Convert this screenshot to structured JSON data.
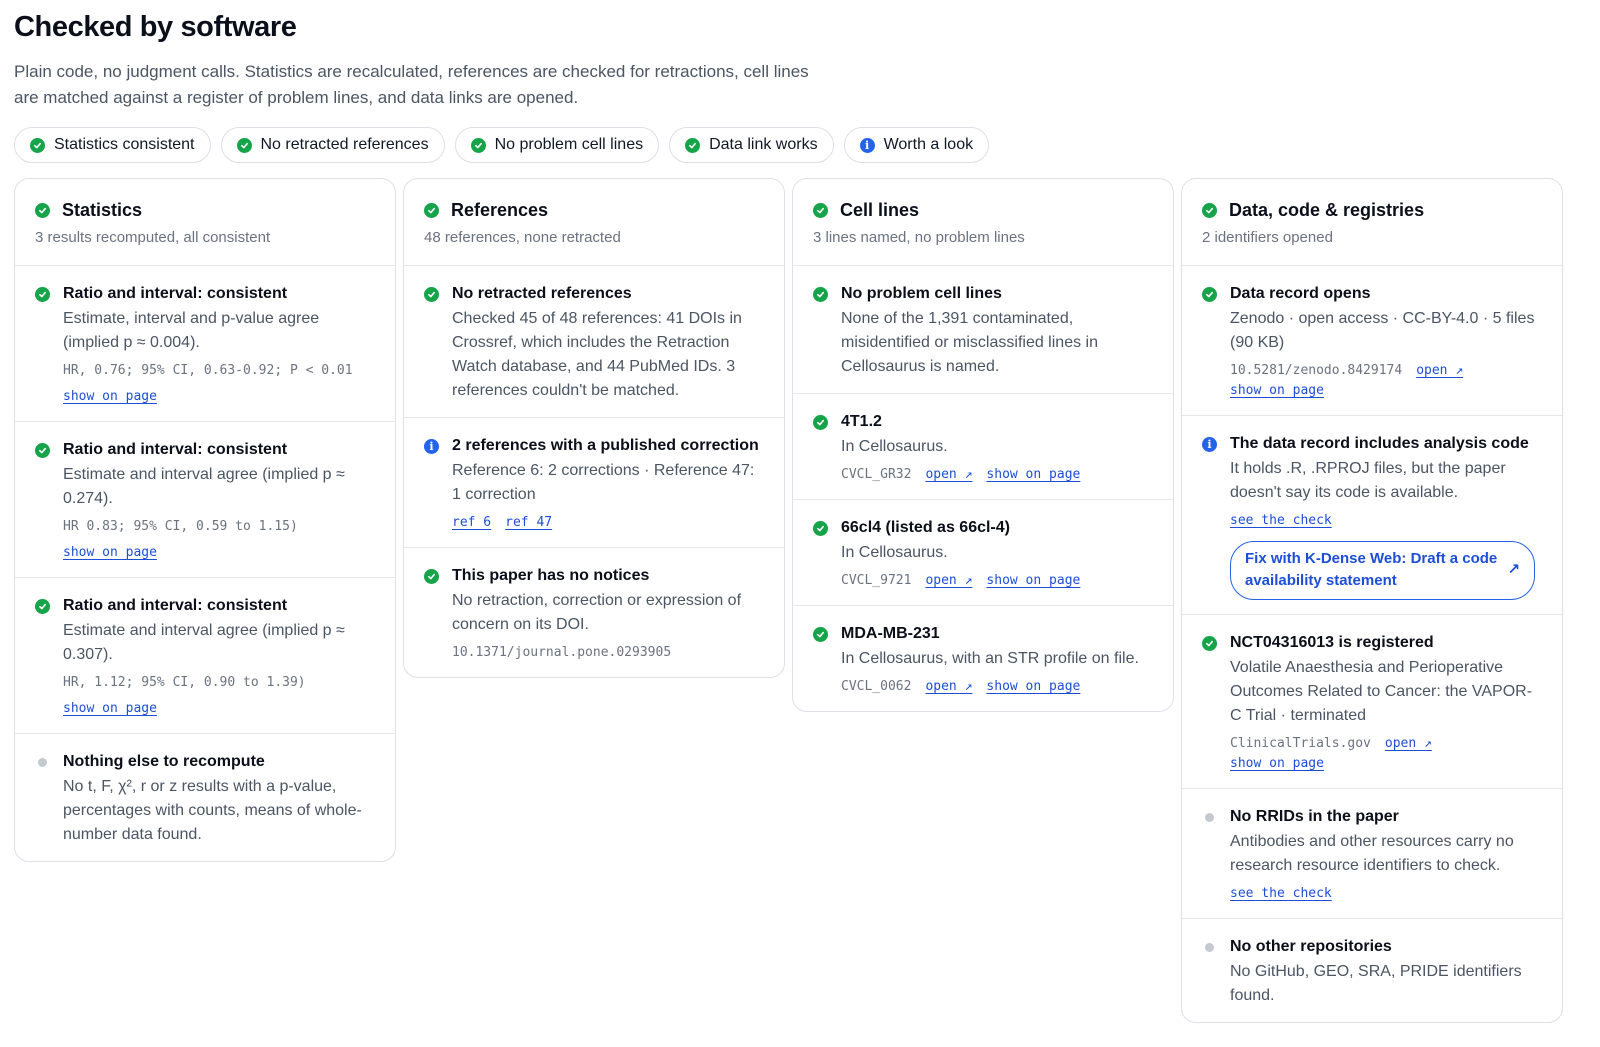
{
  "header": {
    "title": "Checked by software",
    "intro": "Plain code, no judgment calls. Statistics are recalculated, references are checked for retractions, cell lines are matched against a register of problem lines, and data links are opened."
  },
  "chips": [
    {
      "label": "Statistics consistent",
      "status": "ok"
    },
    {
      "label": "No retracted references",
      "status": "ok"
    },
    {
      "label": "No problem cell lines",
      "status": "ok"
    },
    {
      "label": "Data link works",
      "status": "ok"
    },
    {
      "label": "Worth a look",
      "status": "info"
    }
  ],
  "cards": {
    "statistics": {
      "title": "Statistics",
      "subtitle": "3 results recomputed, all consistent",
      "items": [
        {
          "title": "Ratio and interval: consistent",
          "text": "Estimate, interval and p-value agree (implied p ≈ 0.004).",
          "code": "HR, 0.76; 95% CI, 0.63-0.92; P < 0.01",
          "link": "show on page"
        },
        {
          "title": "Ratio and interval: consistent",
          "text": "Estimate and interval agree (implied p ≈ 0.274).",
          "code": "HR 0.83; 95% CI, 0.59 to 1.15)",
          "link": "show on page"
        },
        {
          "title": "Ratio and interval: consistent",
          "text": "Estimate and interval agree (implied p ≈ 0.307).",
          "code": "HR, 1.12; 95% CI, 0.90 to 1.39)",
          "link": "show on page"
        },
        {
          "title": "Nothing else to recompute",
          "text": "No t, F, χ², r or z results with a p-value, percentages with counts, means of whole-number data found."
        }
      ]
    },
    "references": {
      "title": "References",
      "subtitle": "48 references, none retracted",
      "items": [
        {
          "title": "No retracted references",
          "text": "Checked 45 of 48 references: 41 DOIs in Crossref, which includes the Retraction Watch database, and 44 PubMed IDs. 3 references couldn't be matched."
        },
        {
          "title": "2 references with a published correction",
          "text": "Reference 6: 2 corrections · Reference 47: 1 correction",
          "link1": "ref 6",
          "link2": "ref 47"
        },
        {
          "title": "This paper has no notices",
          "text": "No retraction, correction or expression of concern on its DOI.",
          "code": "10.1371/journal.pone.0293905"
        }
      ]
    },
    "celllines": {
      "title": "Cell lines",
      "subtitle": "3 lines named, no problem lines",
      "items": [
        {
          "title": "No problem cell lines",
          "text": "None of the 1,391 contaminated, misidentified or misclassified lines in Cellosaurus is named."
        },
        {
          "title": "4T1.2",
          "text": "In Cellosaurus.",
          "code": "CVCL_GR32",
          "open": "open ↗",
          "link": "show on page"
        },
        {
          "title": "66cl4 (listed as 66cl-4)",
          "text": "In Cellosaurus.",
          "code": "CVCL_9721",
          "open": "open ↗",
          "link": "show on page"
        },
        {
          "title": "MDA-MB-231",
          "text": "In Cellosaurus, with an STR profile on file.",
          "code": "CVCL_0062",
          "open": "open ↗",
          "link": "show on page"
        }
      ]
    },
    "data": {
      "title": "Data, code & registries",
      "subtitle": "2 identifiers opened",
      "items": [
        {
          "title": "Data record opens",
          "text": "Zenodo · open access · CC-BY-4.0 · 5 files (90 KB)",
          "code": "10.5281/zenodo.8429174",
          "open": "open ↗",
          "link": "show on page"
        },
        {
          "title": "The data record includes analysis code",
          "text": "It holds .R, .RPROJ files, but the paper doesn't say its code is available.",
          "link": "see the check",
          "button": "Fix with K-Dense Web: Draft a code availability statement"
        },
        {
          "title": "NCT04316013 is registered",
          "text": "Volatile Anaesthesia and Perioperative Outcomes Related to Cancer: the VAPOR-C Trial · terminated",
          "code": "ClinicalTrials.gov",
          "open": "open ↗",
          "link": "show on page"
        },
        {
          "title": "No RRIDs in the paper",
          "text": "Antibodies and other resources carry no research resource identifiers to check.",
          "link": "see the check"
        },
        {
          "title": "No other repositories",
          "text": "No GitHub, GEO, SRA, PRIDE identifiers found."
        }
      ]
    }
  },
  "colors": {
    "ok": "#16a34a",
    "info": "#2563eb",
    "link": "#1d4ed8",
    "neutral": "#c4c8cf"
  }
}
